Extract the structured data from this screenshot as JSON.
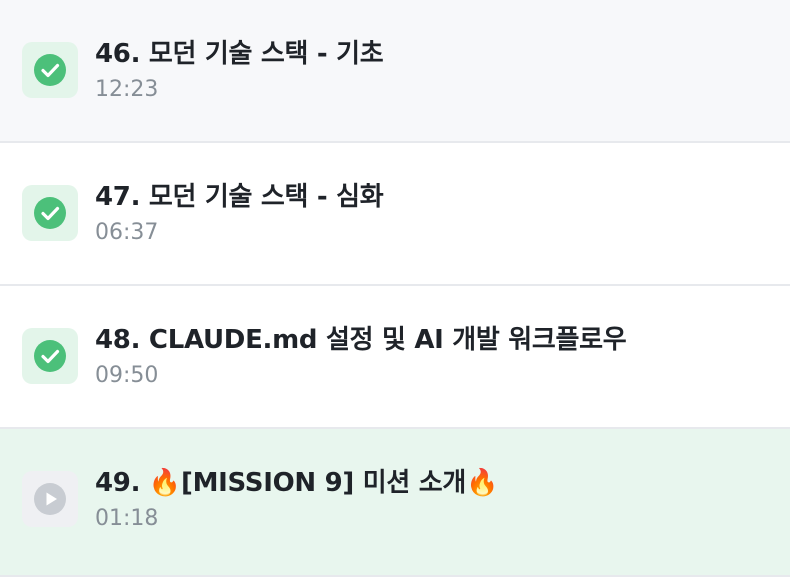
{
  "lessons": [
    {
      "title": "46. 모던 기술 스택 - 기초",
      "duration": "12:23",
      "status": "completed",
      "status_icon": "check-circle-icon"
    },
    {
      "title": "47. 모던 기술 스택 - 심화",
      "duration": "06:37",
      "status": "completed",
      "status_icon": "check-circle-icon"
    },
    {
      "title": "48. CLAUDE.md 설정 및 AI 개발 워크플로우",
      "duration": "09:50",
      "status": "completed",
      "status_icon": "check-circle-icon"
    },
    {
      "title": "49. 🔥[MISSION 9] 미션 소개🔥",
      "duration": "01:18",
      "status": "current",
      "status_icon": "play-circle-icon"
    }
  ],
  "colors": {
    "completed_green": "#4cc07a",
    "play_gray": "#c8ccd2",
    "active_row_bg": "#e8f6ee"
  }
}
